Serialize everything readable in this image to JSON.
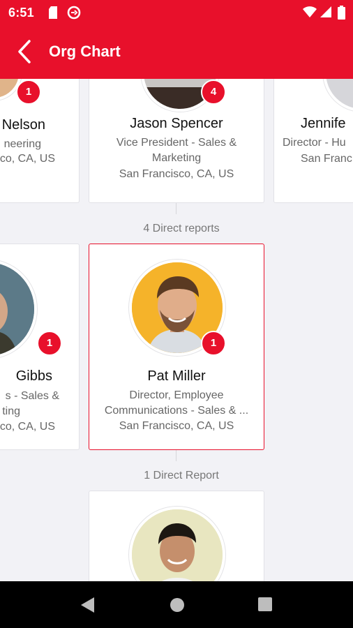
{
  "status_bar": {
    "time": "6:51"
  },
  "app_bar": {
    "title": "Org Chart"
  },
  "row1": {
    "left": {
      "name": "Nelson",
      "title_line1": "neering",
      "location": "co, CA, US",
      "badge": "1"
    },
    "center": {
      "name": "Jason Spencer",
      "title_line1": "Vice President - Sales &",
      "title_line2": "Marketing",
      "location": "San Francisco, CA, US",
      "badge": "4"
    },
    "right": {
      "name": "Jennife",
      "title_line1": "Director - Hu",
      "location": "San Franc"
    }
  },
  "reports_label_1": "4 Direct reports",
  "row2": {
    "left": {
      "name": "Gibbs",
      "title_line1": "s - Sales &",
      "title_line2": "ting",
      "location": "co, CA, US",
      "badge": "1"
    },
    "selected": {
      "name": "Pat Miller",
      "title_line1": "Director, Employee",
      "title_line2": "Communications - Sales & ...",
      "location": "San Francisco, CA, US",
      "badge": "1"
    }
  },
  "reports_label_2": "1 Direct Report"
}
